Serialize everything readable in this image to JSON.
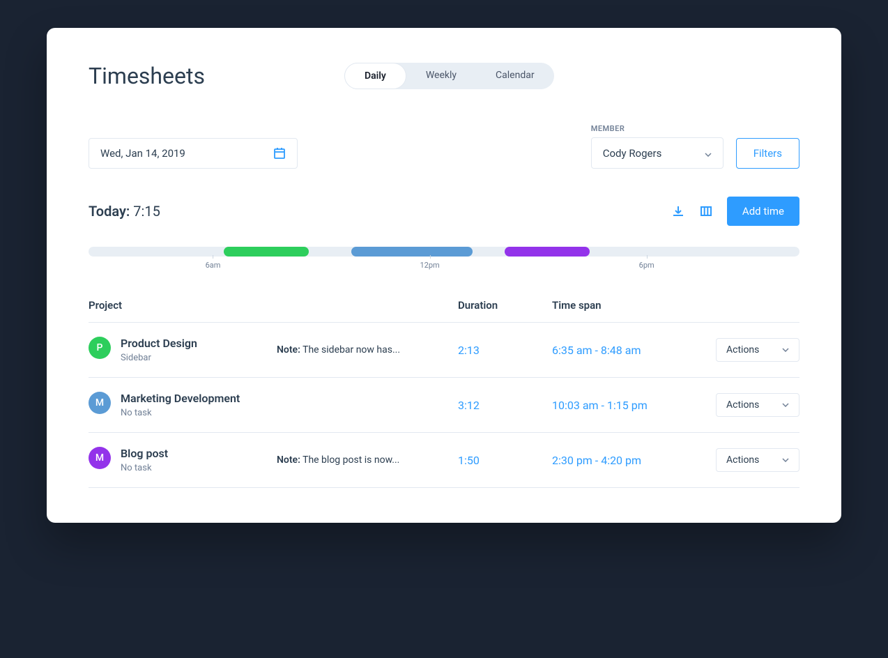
{
  "page": {
    "title": "Timesheets"
  },
  "tabs": {
    "daily": "Daily",
    "weekly": "Weekly",
    "calendar": "Calendar"
  },
  "datePicker": {
    "value": "Wed, Jan 14, 2019"
  },
  "member": {
    "label": "MEMBER",
    "value": "Cody Rogers"
  },
  "filters": {
    "label": "Filters"
  },
  "today": {
    "label": "Today:",
    "value": "7:15"
  },
  "addTime": {
    "label": "Add time"
  },
  "timeline": {
    "ticks": [
      "6am",
      "12pm",
      "6pm"
    ]
  },
  "table": {
    "headers": {
      "project": "Project",
      "duration": "Duration",
      "timespan": "Time span"
    },
    "rows": [
      {
        "avatar": "P",
        "avatarColor": "green",
        "project": "Product Design",
        "sub": "Sidebar",
        "notePrefix": "Note:",
        "note": " The sidebar now has...",
        "duration": "2:13",
        "timespan": "6:35 am - 8:48 am",
        "action": "Actions"
      },
      {
        "avatar": "M",
        "avatarColor": "blue",
        "project": "Marketing Development",
        "sub": "No task",
        "notePrefix": "",
        "note": "",
        "duration": "3:12",
        "timespan": "10:03 am - 1:15 pm",
        "action": "Actions"
      },
      {
        "avatar": "M",
        "avatarColor": "purple",
        "project": "Blog post",
        "sub": "No task",
        "notePrefix": "Note:",
        "note": " The blog post is now...",
        "duration": "1:50",
        "timespan": "2:30 pm - 4:20 pm",
        "action": "Actions"
      }
    ]
  }
}
